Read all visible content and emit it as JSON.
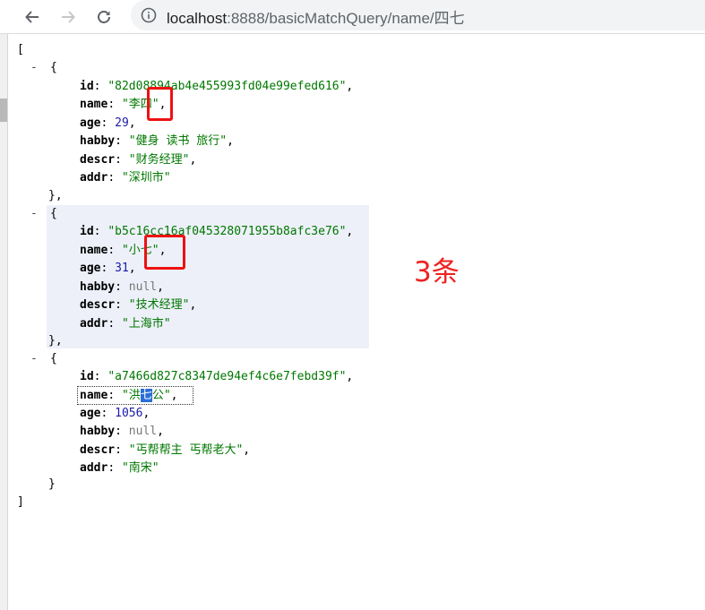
{
  "browser": {
    "back_icon": "arrow-left-icon",
    "forward_icon": "arrow-right-icon",
    "reload_icon": "reload-icon",
    "info_icon": "info-icon",
    "url_host": "localhost",
    "url_path": ":8888/basicMatchQuery/name/四七"
  },
  "json": {
    "open_bracket": "[",
    "close_bracket": "]",
    "records": [
      {
        "id": "\"82d08894ab4e455993fd04e99efed616\"",
        "name": "\"李四\"",
        "age": "29",
        "habby": "\"健身 读书 旅行\"",
        "descr": "\"财务经理\"",
        "addr": "\"深圳市\""
      },
      {
        "id": "\"b5c16cc16af045328071955b8afc3e76\"",
        "name": "\"小七\"",
        "age": "31",
        "habby": "null",
        "descr": "\"技术经理\"",
        "addr": "\"上海市\""
      },
      {
        "id": "\"a7466d827c8347de94ef4c6e7febd39f\"",
        "name_pre": "\"洪",
        "name_sel": "七",
        "name_post": "公\"",
        "age": "1056",
        "habby": "null",
        "descr": "\"丐帮帮主 丐帮老大\"",
        "addr": "\"南宋\""
      }
    ]
  },
  "annotation": {
    "count_note": "3条"
  }
}
